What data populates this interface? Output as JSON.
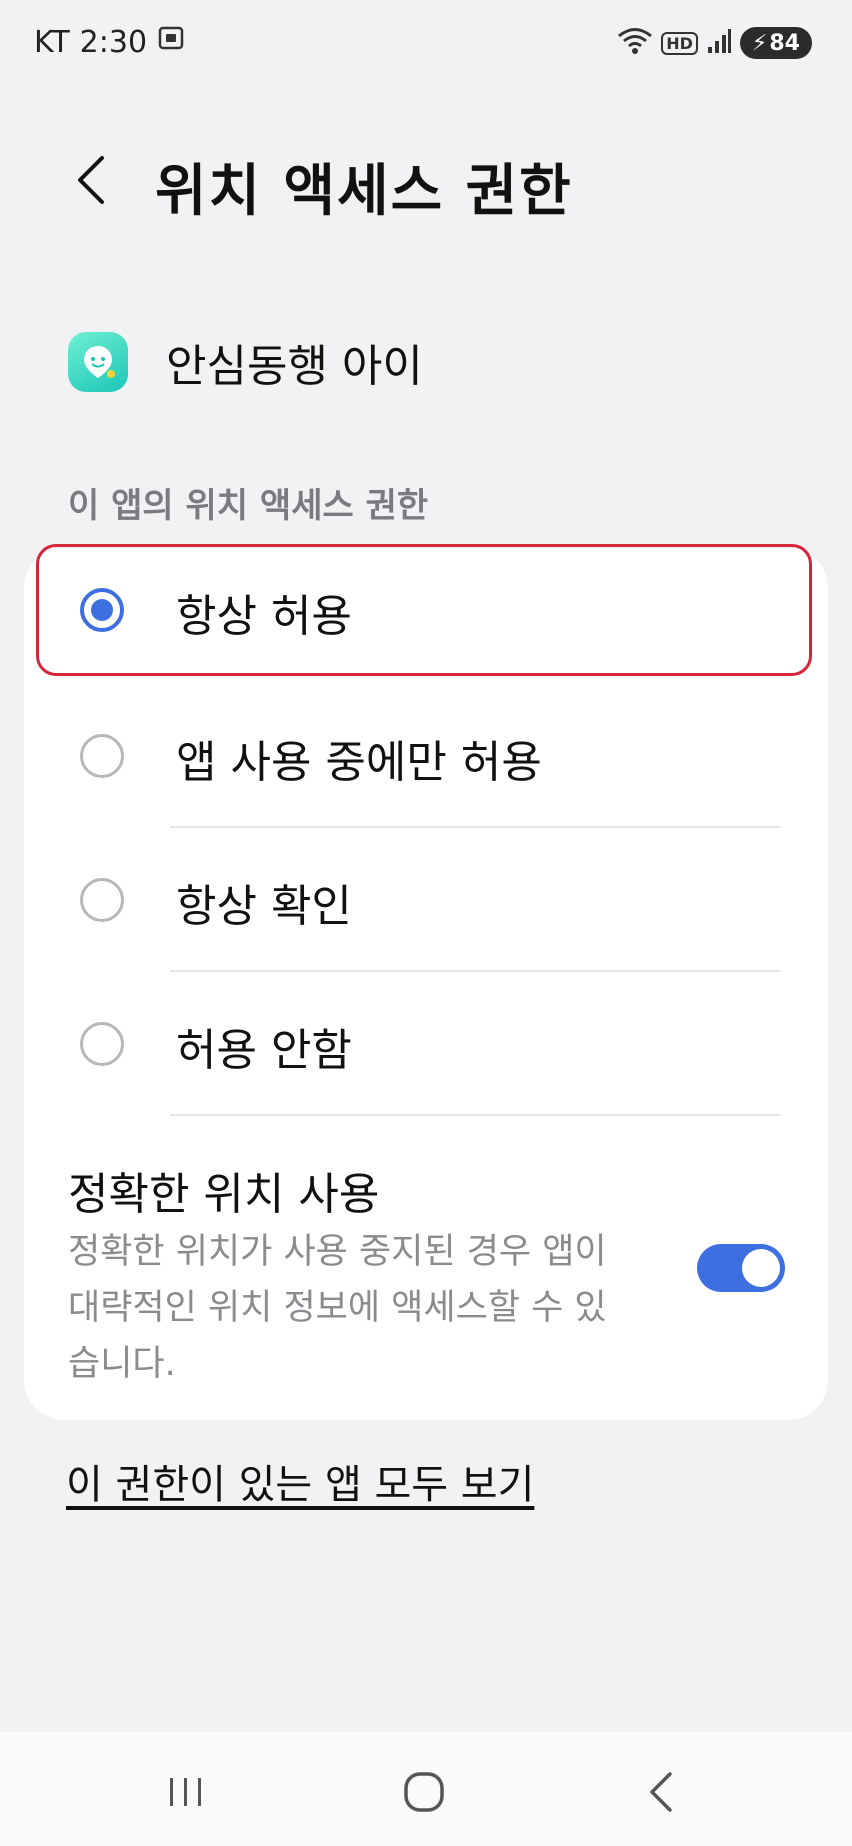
{
  "status_bar": {
    "carrier": "KT",
    "time": "2:30",
    "network_badge": "HD",
    "battery_level": "84"
  },
  "header": {
    "title": "위치 액세스 권한"
  },
  "app": {
    "name": "안심동행 아이",
    "icon": "app-icon"
  },
  "permission": {
    "section_label": "이 앱의 위치 액세스 권한",
    "options": [
      {
        "label": "항상 허용",
        "selected": true
      },
      {
        "label": "앱 사용 중에만 허용",
        "selected": false
      },
      {
        "label": "항상 확인",
        "selected": false
      },
      {
        "label": "허용 안함",
        "selected": false
      }
    ]
  },
  "precise_location": {
    "title": "정확한 위치 사용",
    "description": "정확한 위치가 사용 중지된 경우 앱이 대략적인 위치 정보에 액세스할 수 있습니다.",
    "enabled": true
  },
  "footer_link": "이 권한이 있는 앱 모두 보기",
  "colors": {
    "accent": "#3d6fe0",
    "highlight": "#d6253b",
    "background": "#f2f2f4"
  }
}
